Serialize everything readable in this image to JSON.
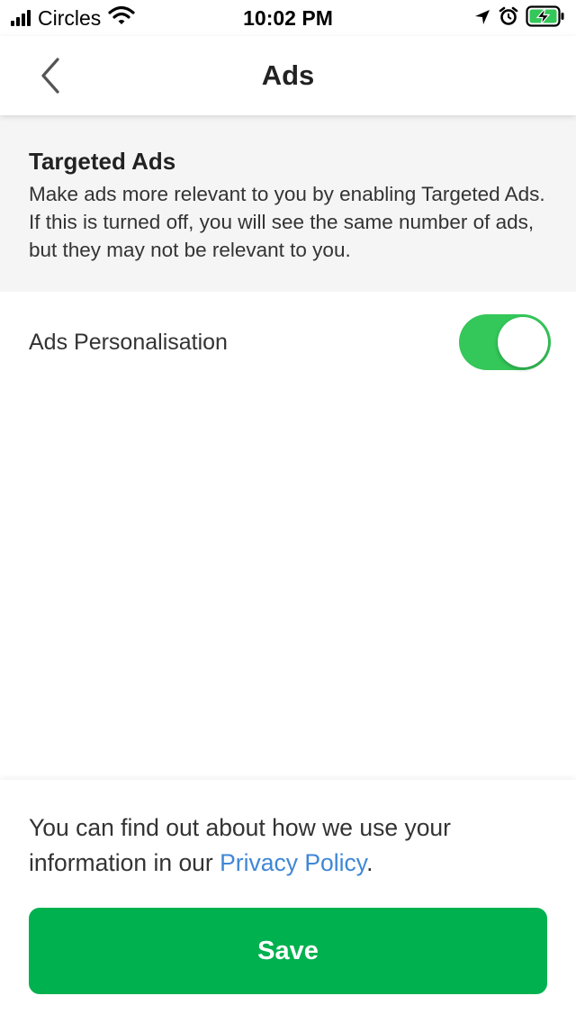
{
  "status_bar": {
    "carrier": "Circles",
    "time": "10:02 PM",
    "battery_color": "#34c759"
  },
  "nav": {
    "back_icon": "chevron-left-icon",
    "title": "Ads"
  },
  "info": {
    "title": "Targeted Ads",
    "description": "Make ads more relevant to you by enabling Targeted Ads. If this is turned off, you will see the same number of ads, but they may not be relevant to you."
  },
  "setting": {
    "label": "Ads Personalisation",
    "enabled": true,
    "toggle_color": "#34c759"
  },
  "footer": {
    "text_before": "You can find out about how we use your information in our ",
    "link_text": "Privacy Policy",
    "text_after": ".",
    "link_color": "#3f87d6"
  },
  "save_button": {
    "label": "Save",
    "color": "#00b14f"
  }
}
